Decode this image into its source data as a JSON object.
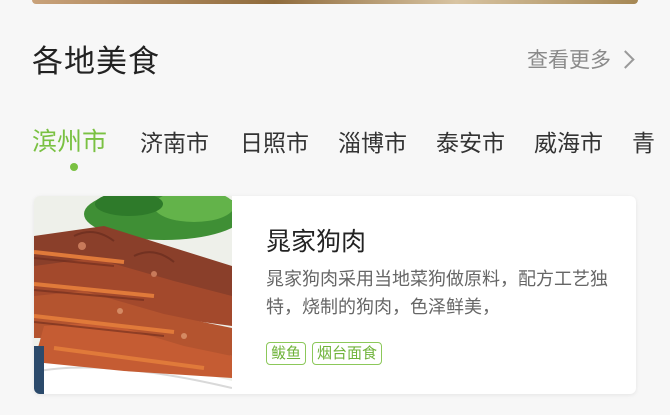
{
  "section": {
    "title": "各地美食",
    "more_label": "查看更多"
  },
  "tabs": [
    "滨州市",
    "济南市",
    "日照市",
    "淄博市",
    "泰安市",
    "威海市",
    "青"
  ],
  "active_tab": "滨州市",
  "card": {
    "title": "晁家狗肉",
    "description": "晁家狗肉采用当地菜狗做原料，配方工艺独特，烧制的狗肉，色泽鲜美，",
    "tags": [
      "鲅鱼",
      "烟台面食"
    ]
  },
  "colors": {
    "accent": "#7ac142",
    "title": "#222222",
    "muted": "#8a8a8a"
  }
}
